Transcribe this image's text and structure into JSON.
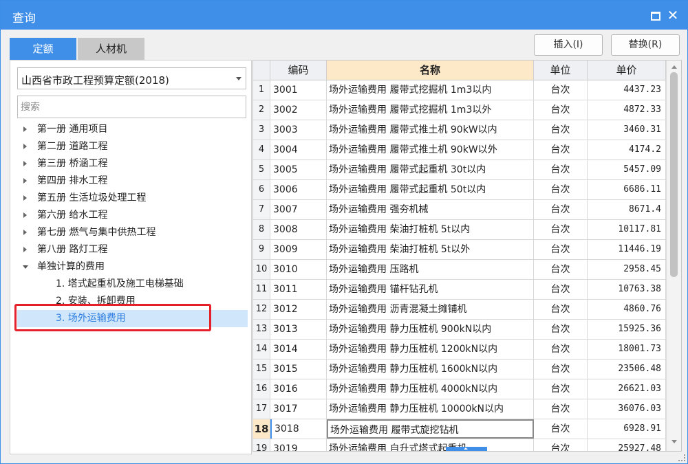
{
  "window": {
    "title": "查询"
  },
  "tabs": [
    {
      "label": "定额",
      "active": true
    },
    {
      "label": "人材机",
      "active": false
    }
  ],
  "toolbar": {
    "insert_label": "插入(I)",
    "replace_label": "替换(R)"
  },
  "left": {
    "quota_select": "山西省市政工程预算定额(2018)",
    "search_placeholder": "搜索",
    "tree": [
      {
        "label": "第一册 通用项目",
        "expanded": false
      },
      {
        "label": "第二册 道路工程",
        "expanded": false
      },
      {
        "label": "第三册 桥涵工程",
        "expanded": false
      },
      {
        "label": "第四册 排水工程",
        "expanded": false
      },
      {
        "label": "第五册 生活垃圾处理工程",
        "expanded": false
      },
      {
        "label": "第六册 给水工程",
        "expanded": false
      },
      {
        "label": "第七册 燃气与集中供热工程",
        "expanded": false
      },
      {
        "label": "第八册 路灯工程",
        "expanded": false
      },
      {
        "label": "单独计算的费用",
        "expanded": true
      },
      {
        "label": "1. 塔式起重机及施工电梯基础",
        "child": true
      },
      {
        "label": "2. 安装、拆卸费用",
        "child": true
      },
      {
        "label": "3. 场外运输费用",
        "child": true,
        "selected": true
      }
    ]
  },
  "grid": {
    "columns": [
      "编码",
      "名称",
      "单位",
      "单价"
    ],
    "rows": [
      {
        "idx": "1",
        "code": "3001",
        "name": "场外运输费用 履带式挖掘机 1m3以内",
        "unit": "台次",
        "price": "4437.23"
      },
      {
        "idx": "2",
        "code": "3002",
        "name": "场外运输费用 履带式挖掘机 1m3以外",
        "unit": "台次",
        "price": "4872.33"
      },
      {
        "idx": "3",
        "code": "3003",
        "name": "场外运输费用 履带式推土机 90kW以内",
        "unit": "台次",
        "price": "3460.31"
      },
      {
        "idx": "4",
        "code": "3004",
        "name": "场外运输费用 履带式推土机 90kW以外",
        "unit": "台次",
        "price": "4174.2"
      },
      {
        "idx": "5",
        "code": "3005",
        "name": "场外运输费用 履带式起重机 30t以内",
        "unit": "台次",
        "price": "5457.09"
      },
      {
        "idx": "6",
        "code": "3006",
        "name": "场外运输费用 履带式起重机 50t以内",
        "unit": "台次",
        "price": "6686.11"
      },
      {
        "idx": "7",
        "code": "3007",
        "name": "场外运输费用 强夯机械",
        "unit": "台次",
        "price": "8671.4"
      },
      {
        "idx": "8",
        "code": "3008",
        "name": "场外运输费用 柴油打桩机 5t以内",
        "unit": "台次",
        "price": "10117.81"
      },
      {
        "idx": "9",
        "code": "3009",
        "name": "场外运输费用 柴油打桩机 5t以外",
        "unit": "台次",
        "price": "11446.19"
      },
      {
        "idx": "10",
        "code": "3010",
        "name": "场外运输费用 压路机",
        "unit": "台次",
        "price": "2958.45"
      },
      {
        "idx": "11",
        "code": "3011",
        "name": "场外运输费用 锚杆钻孔机",
        "unit": "台次",
        "price": "10763.38"
      },
      {
        "idx": "12",
        "code": "3012",
        "name": "场外运输费用 沥青混凝土摊铺机",
        "unit": "台次",
        "price": "4860.76"
      },
      {
        "idx": "13",
        "code": "3013",
        "name": "场外运输费用 静力压桩机 900kN以内",
        "unit": "台次",
        "price": "15925.36"
      },
      {
        "idx": "14",
        "code": "3014",
        "name": "场外运输费用 静力压桩机 1200kN以内",
        "unit": "台次",
        "price": "18001.73"
      },
      {
        "idx": "15",
        "code": "3015",
        "name": "场外运输费用 静力压桩机 1600kN以内",
        "unit": "台次",
        "price": "23506.48"
      },
      {
        "idx": "16",
        "code": "3016",
        "name": "场外运输费用 静力压桩机 4000kN以内",
        "unit": "台次",
        "price": "26621.03"
      },
      {
        "idx": "17",
        "code": "3017",
        "name": "场外运输费用 静力压桩机 10000kN以内",
        "unit": "台次",
        "price": "36076.03"
      },
      {
        "idx": "18",
        "code": "3018",
        "name": "场外运输费用 履带式旋挖钻机",
        "unit": "台次",
        "price": "6928.91",
        "active": true
      },
      {
        "idx": "19",
        "code": "3019",
        "name": "场外运输费用 自升式塔式起重机",
        "unit": "台次",
        "price": "25927.48"
      }
    ]
  },
  "colors": {
    "accent": "#3f8fe8",
    "highlight": "#e5202b",
    "selected_bg": "#cfe6fb",
    "header_name_bg": "#fde9c8"
  }
}
